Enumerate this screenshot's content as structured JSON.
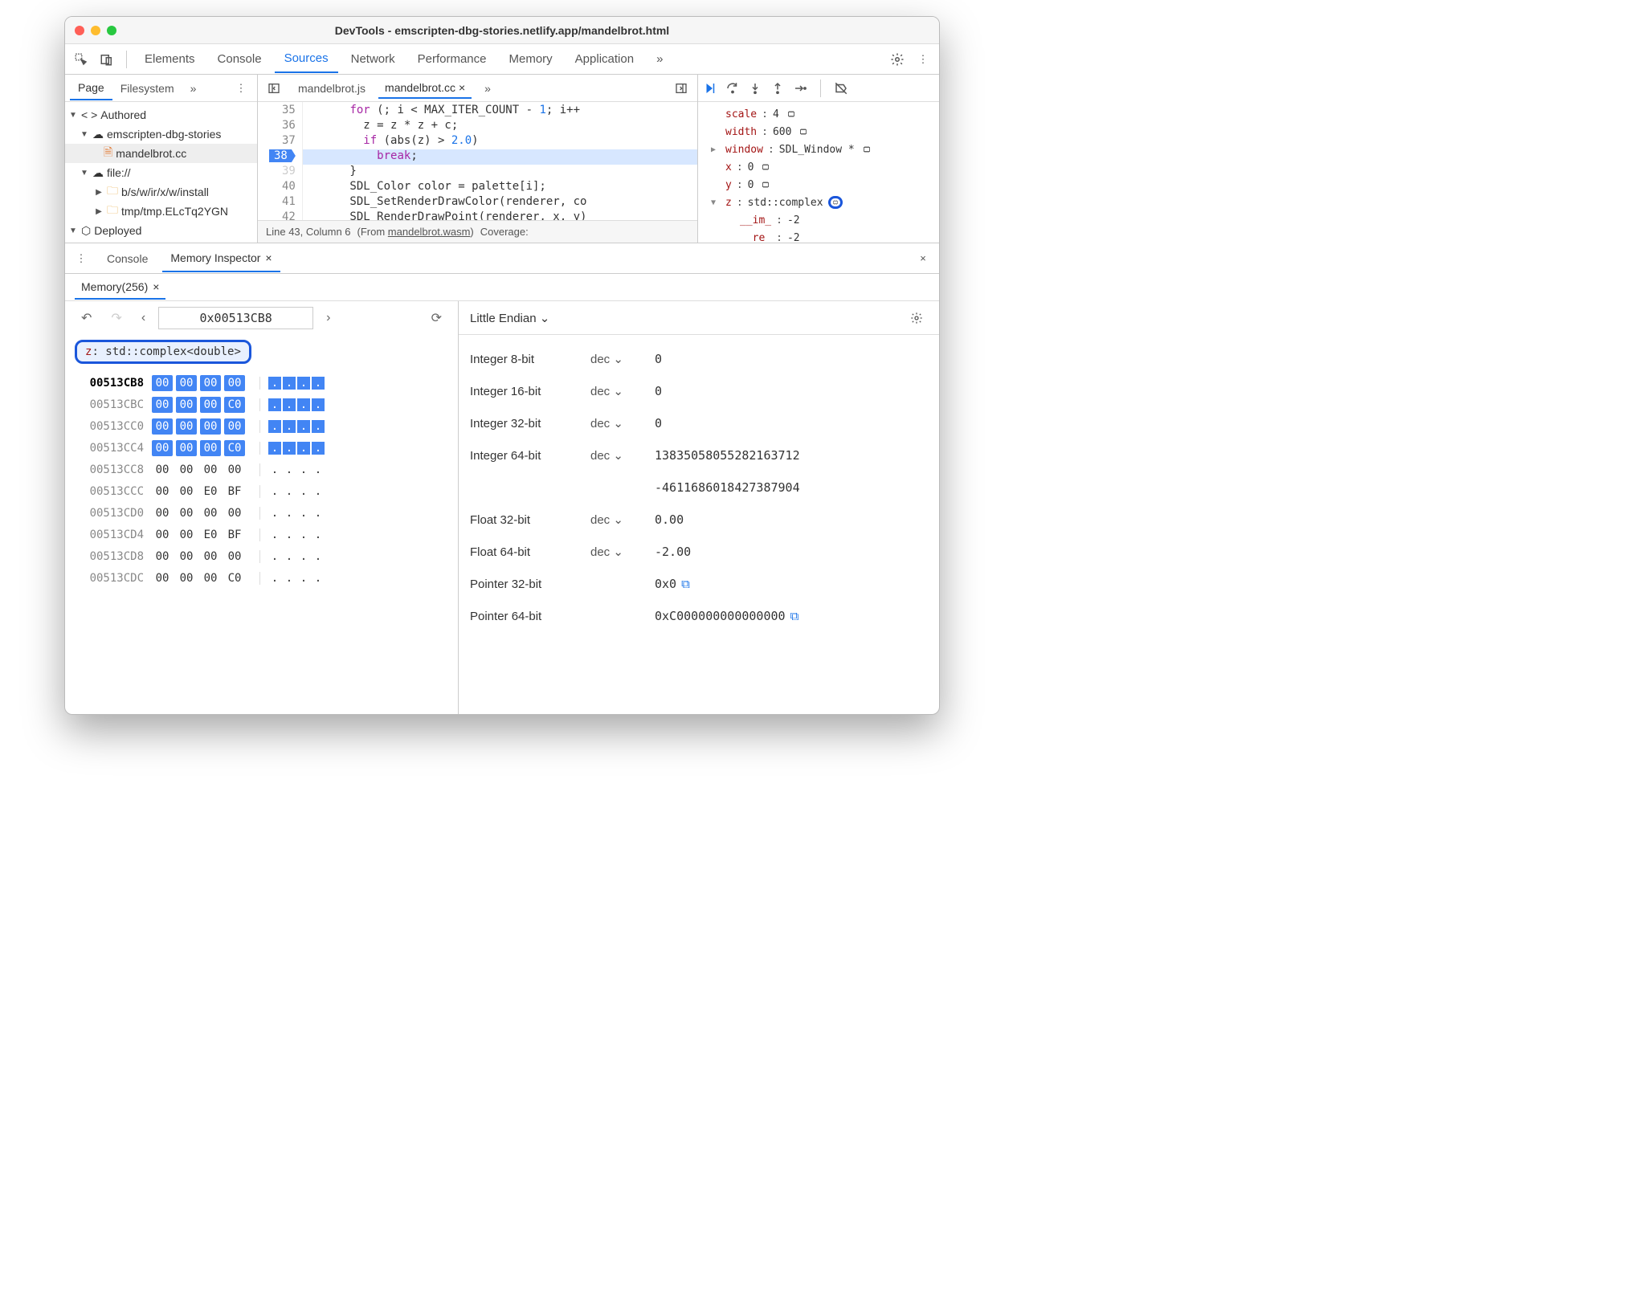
{
  "window": {
    "title": "DevTools - emscripten-dbg-stories.netlify.app/mandelbrot.html"
  },
  "main_tabs": [
    "Elements",
    "Console",
    "Sources",
    "Network",
    "Performance",
    "Memory",
    "Application"
  ],
  "main_active": "Sources",
  "left": {
    "tabs": [
      "Page",
      "Filesystem"
    ],
    "active": "Page",
    "tree": {
      "authored": "Authored",
      "origin": "emscripten-dbg-stories",
      "file": "mandelbrot.cc",
      "file_scheme": "file://",
      "folder1": "b/s/w/ir/x/w/install",
      "folder2": "tmp/tmp.ELcTq2YGN",
      "deployed": "Deployed"
    }
  },
  "center": {
    "tabs": [
      "mandelbrot.js",
      "mandelbrot.cc"
    ],
    "active": "mandelbrot.cc",
    "lines": [
      {
        "n": 35,
        "code": "      for (; i < MAX_ITER_COUNT - 1; i++"
      },
      {
        "n": 36,
        "code": "        z = z * z + c;"
      },
      {
        "n": 37,
        "code": "        if (abs(z) > 2.0)"
      },
      {
        "n": 38,
        "code": "          break;",
        "hl": true
      },
      {
        "n": 39,
        "code": "      }"
      },
      {
        "n": 40,
        "code": "      SDL_Color color = palette[i];"
      },
      {
        "n": 41,
        "code": "      SDL_SetRenderDrawColor(renderer, co"
      },
      {
        "n": 42,
        "code": "      SDL_RenderDrawPoint(renderer, x, y)"
      }
    ],
    "status": {
      "pos": "Line 43, Column 6",
      "from": "(From ",
      "wasm": "mandelbrot.wasm",
      "cov": "Coverage:"
    }
  },
  "scope": [
    {
      "name": "scale",
      "val": "4",
      "chip": true
    },
    {
      "name": "width",
      "val": "600",
      "chip": true
    },
    {
      "name": "window",
      "val": "SDL_Window *",
      "chip": true,
      "arrow": true
    },
    {
      "name": "x",
      "val": "0",
      "chip": true
    },
    {
      "name": "y",
      "val": "0",
      "chip": true
    },
    {
      "name": "z",
      "val": "std::complex<double>",
      "chip": true,
      "arrow": true,
      "open": true,
      "ring": true
    },
    {
      "name": "__im_",
      "val": "-2",
      "indent": true
    },
    {
      "name": "__re_",
      "val": "-2",
      "indent": true
    }
  ],
  "drawer": {
    "tabs": [
      "Console",
      "Memory Inspector"
    ],
    "active": "Memory Inspector",
    "memtab": "Memory(256)",
    "address": "0x00513CB8",
    "chip": "z: std::complex<double>",
    "endian": "Little Endian",
    "rows": [
      {
        "addr": "00513CB8",
        "b": [
          "00",
          "00",
          "00",
          "00"
        ],
        "hl": true,
        "bold": true
      },
      {
        "addr": "00513CBC",
        "b": [
          "00",
          "00",
          "00",
          "C0"
        ],
        "hl": true
      },
      {
        "addr": "00513CC0",
        "b": [
          "00",
          "00",
          "00",
          "00"
        ],
        "hl": true
      },
      {
        "addr": "00513CC4",
        "b": [
          "00",
          "00",
          "00",
          "C0"
        ],
        "hl": true
      },
      {
        "addr": "00513CC8",
        "b": [
          "00",
          "00",
          "00",
          "00"
        ]
      },
      {
        "addr": "00513CCC",
        "b": [
          "00",
          "00",
          "E0",
          "BF"
        ]
      },
      {
        "addr": "00513CD0",
        "b": [
          "00",
          "00",
          "00",
          "00"
        ]
      },
      {
        "addr": "00513CD4",
        "b": [
          "00",
          "00",
          "E0",
          "BF"
        ]
      },
      {
        "addr": "00513CD8",
        "b": [
          "00",
          "00",
          "00",
          "00"
        ]
      },
      {
        "addr": "00513CDC",
        "b": [
          "00",
          "00",
          "00",
          "C0"
        ]
      }
    ],
    "values": [
      {
        "label": "Integer 8-bit",
        "fmt": "dec",
        "val": "0"
      },
      {
        "label": "Integer 16-bit",
        "fmt": "dec",
        "val": "0"
      },
      {
        "label": "Integer 32-bit",
        "fmt": "dec",
        "val": "0"
      },
      {
        "label": "Integer 64-bit",
        "fmt": "dec",
        "val": "13835058055282163712",
        "val2": "-4611686018427387904"
      },
      {
        "label": "Float 32-bit",
        "fmt": "dec",
        "val": "0.00"
      },
      {
        "label": "Float 64-bit",
        "fmt": "dec",
        "val": "-2.00"
      },
      {
        "label": "Pointer 32-bit",
        "fmt": "",
        "val": "0x0",
        "link": true
      },
      {
        "label": "Pointer 64-bit",
        "fmt": "",
        "val": "0xC000000000000000",
        "link": true
      }
    ]
  }
}
